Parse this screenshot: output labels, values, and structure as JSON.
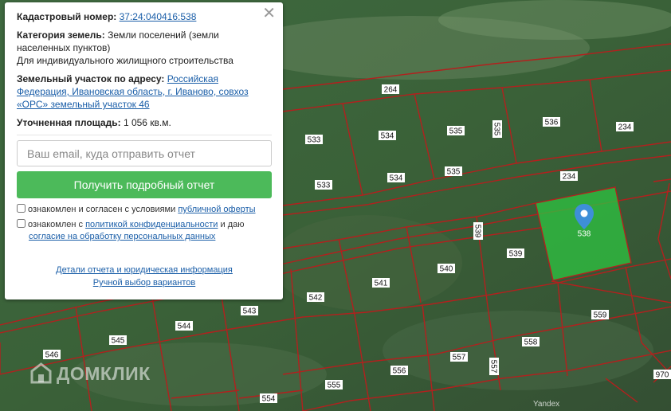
{
  "popup": {
    "close_icon": "close-icon",
    "cadastral_label": "Кадастровый номер:",
    "cadastral_number": "37:24:040416:538",
    "category_label": "Категория земель:",
    "category_value": "Земли поселений (земли населенных пунктов)",
    "use_value": "Для индивидуального жилищного строительства",
    "address_label": "Земельный участок по адресу:",
    "address_value": "Российская Федерация, Ивановская область, г. Иваново, совхоз «ОРС» земельный участок 46",
    "area_label": "Уточненная площадь:",
    "area_value": "1 056 кв.м.",
    "email_placeholder": "Ваш email, куда отправить отчет",
    "cta_label": "Получить подробный отчет",
    "consent1_text": "ознакомлен и согласен с условиями",
    "consent1_link": "публичной оферты",
    "consent2_text": "ознакомлен с",
    "consent2_link": "политикой конфиденциальности",
    "consent2_mid": "и даю",
    "consent2_link2": "согласие на обработку персональных данных",
    "details_link": "Детали отчета и юридическая информация",
    "manual_link": "Ручной выбор вариантов"
  },
  "brand": {
    "name": "ДОМКЛИК",
    "logo_icon": "domclick-house-icon"
  },
  "map_attribution": "Yandex",
  "map": {
    "selected_plot": "538",
    "marker_icon": "map-pin-icon",
    "colors": {
      "boundary": "#b3201e",
      "selected_fill": "#2ec040",
      "marker": "#3e8fd8"
    },
    "plot_labels": [
      "264",
      "533",
      "534",
      "535",
      "535",
      "536",
      "234",
      "533",
      "534",
      "535",
      "234",
      "538",
      "539",
      "539",
      "540",
      "541",
      "542",
      "543",
      "544",
      "545",
      "546",
      "556",
      "557",
      "557",
      "558",
      "559",
      "554",
      "555",
      "970"
    ]
  }
}
